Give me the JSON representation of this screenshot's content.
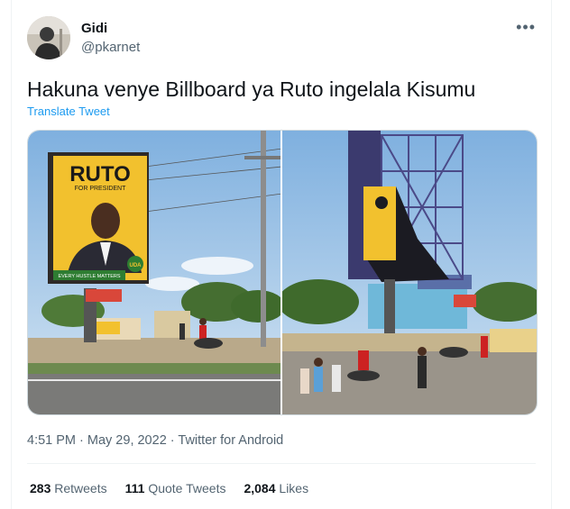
{
  "author": {
    "name": "Gidi",
    "handle": "@pkarnet",
    "more_icon": "more-dots-icon"
  },
  "tweet": {
    "text": "Hakuna venye Billboard ya Ruto ingelala Kisumu",
    "translate_label": "Translate Tweet"
  },
  "media": {
    "left_billboard_title": "RUTO",
    "left_billboard_subtitle": "FOR PRESIDENT",
    "left_billboard_tagline": "EVERY HUSTLE MATTERS",
    "left_billboard_badge": "UDA"
  },
  "meta": {
    "time": "4:51 PM",
    "date": "May 29, 2022",
    "source": "Twitter for Android"
  },
  "stats": {
    "retweets_count": "283",
    "retweets_label": "Retweets",
    "quotes_count": "111",
    "quotes_label": "Quote Tweets",
    "likes_count": "2,084",
    "likes_label": "Likes"
  },
  "colors": {
    "link": "#1d9bf0",
    "secondary_text": "#536471",
    "billboard_yellow": "#f2c12e"
  }
}
